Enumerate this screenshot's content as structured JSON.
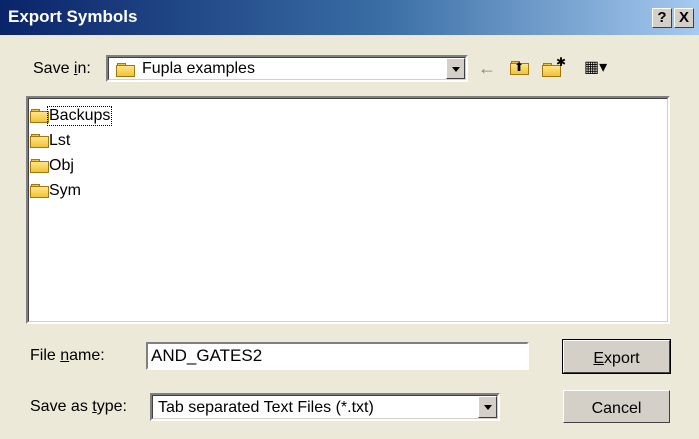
{
  "window": {
    "title": "Export Symbols",
    "help_glyph": "?",
    "close_glyph": "X"
  },
  "save_in": {
    "label_pre": "Save ",
    "label_hot": "i",
    "label_post": "n:",
    "value": "Fupla examples"
  },
  "toolbar": {
    "back_glyph": "←",
    "up_glyph": "⬆",
    "new_folder_glyph": "✱",
    "view_glyph": "▦▾"
  },
  "files": [
    {
      "name": "Backups"
    },
    {
      "name": "Lst"
    },
    {
      "name": "Obj"
    },
    {
      "name": "Sym"
    }
  ],
  "file_name": {
    "label_pre": "File ",
    "label_hot": "n",
    "label_post": "ame:",
    "value": "AND_GATES2"
  },
  "save_type": {
    "label_pre": "Save as ",
    "label_hot": "t",
    "label_post": "ype:",
    "value": "Tab separated Text Files (*.txt)"
  },
  "buttons": {
    "export_hot": "E",
    "export_rest": "xport",
    "cancel": "Cancel"
  }
}
